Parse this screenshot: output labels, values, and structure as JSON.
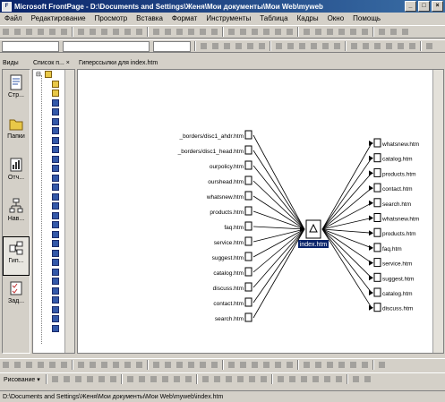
{
  "window": {
    "title": "Microsoft FrontPage - D:\\Documents and Settings\\Женя\\Мои документы\\Мои Web\\myweb"
  },
  "menu": [
    "Файл",
    "Редактирование",
    "Просмотр",
    "Вставка",
    "Формат",
    "Инструменты",
    "Таблица",
    "Кадры",
    "Окно",
    "Помощь"
  ],
  "views": {
    "header": "Виды",
    "items": [
      {
        "label": "Стр...",
        "icon": "page-view-icon"
      },
      {
        "label": "Папки",
        "icon": "folders-view-icon"
      },
      {
        "label": "Отч...",
        "icon": "reports-view-icon"
      },
      {
        "label": "Нав...",
        "icon": "navigation-view-icon"
      },
      {
        "label": "Гип...",
        "icon": "hyperlinks-view-icon"
      },
      {
        "label": "Зад...",
        "icon": "tasks-view-icon"
      }
    ]
  },
  "folder_list": {
    "header": "Список п... ×"
  },
  "hyperlinks": {
    "header": "Гиперссылки для index.htm",
    "center": "index.htm",
    "incoming": [
      "_borders/disc1_ahdr.htm",
      "_borders/disc1_head.htm",
      "ourpolicy.htm",
      "ourshead.htm",
      "whatsnew.htm",
      "products.htm",
      "faq.htm",
      "service.htm",
      "suggest.htm",
      "catalog.htm",
      "discuss.htm",
      "contact.htm",
      "search.htm"
    ],
    "outgoing": [
      "whatsnew.htm",
      "catalog.htm",
      "products.htm",
      "contact.htm",
      "search.htm",
      "whatsnew.htm",
      "products.htm",
      "faq.htm",
      "service.htm",
      "suggest.htm",
      "catalog.htm",
      "discuss.htm"
    ]
  },
  "drawing_toolbar": {
    "draw_label": "Рисование ▾"
  },
  "status": {
    "path": "D:\\Documents and Settings\\Женя\\Мои документы\\Мои Web\\myweb\\index.htm"
  }
}
